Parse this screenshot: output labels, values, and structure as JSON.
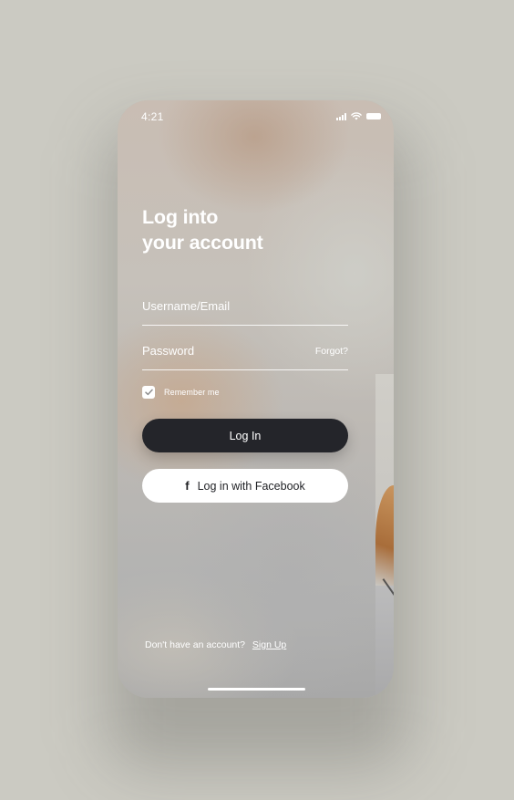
{
  "status_bar": {
    "time": "4:21",
    "icons": [
      "signal-icon",
      "wifi-icon",
      "battery-icon"
    ]
  },
  "login": {
    "heading_line1": "Log into",
    "heading_line2": "your account",
    "username_placeholder": "Username/Email",
    "password_placeholder": "Password",
    "forgot_label": "Forgot?",
    "remember_label": "Remember me",
    "remember_checked": true,
    "login_button": "Log In",
    "facebook_button": "Log in with Facebook",
    "facebook_icon": "facebook-icon",
    "signup_prompt": "Don't have an account?",
    "signup_link": "Sign Up"
  },
  "colors": {
    "page_background": "#cbcac2",
    "primary_button": "#24252a",
    "secondary_button": "#ffffff",
    "text": "#ffffff"
  }
}
